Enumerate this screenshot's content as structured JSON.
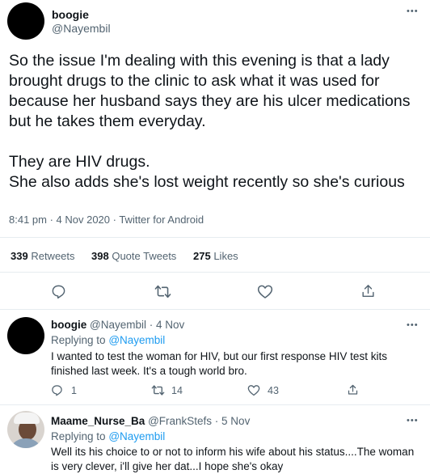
{
  "tweet": {
    "name": "boogie",
    "handle": "@Nayembil",
    "text": "So the issue I'm dealing with this evening is that a lady brought drugs to the clinic to ask what it was used for because her husband says they are his ulcer medications but he takes them everyday.\n\nThey are HIV drugs.\nShe also adds she's lost weight recently so she's curious",
    "meta": "8:41 pm · 4 Nov 2020 · Twitter for Android",
    "stats": {
      "retweets_count": "339",
      "retweets_label": "Retweets",
      "quotes_count": "398",
      "quotes_label": "Quote Tweets",
      "likes_count": "275",
      "likes_label": "Likes"
    }
  },
  "replies": [
    {
      "name": "boogie",
      "handle_date": "@Nayembil · 4 Nov",
      "replying_prefix": "Replying to",
      "replying_to": "@Nayembil",
      "text": "I wanted to test the woman for HIV, but our first response HIV test kits\nfinished last week. It's a tough world bro.",
      "reply_count": "1",
      "retweet_count": "14",
      "like_count": "43"
    },
    {
      "name": "Maame_Nurse_Ba",
      "handle_date": "@FrankStefs · 5 Nov",
      "replying_prefix": "Replying to",
      "replying_to": "@Nayembil",
      "text": "Well its his choice to or not to inform his wife about his status....The woman\nis very clever, i'll give her dat...I hope she's okay"
    }
  ],
  "colors": {
    "accent": "#1d9bf0",
    "text": "#0f1419",
    "muted": "#536471",
    "divider": "#e6ecf0"
  }
}
